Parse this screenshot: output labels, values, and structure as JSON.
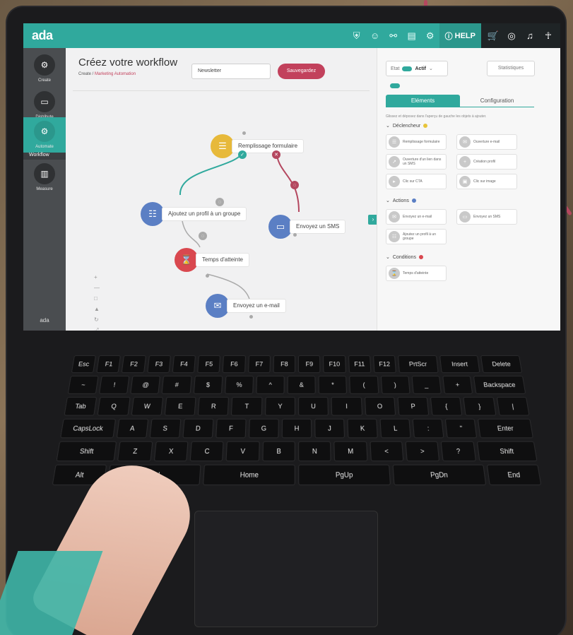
{
  "app": {
    "logo": "ada",
    "help_label": "HELP"
  },
  "topbar": {
    "icons": [
      "shield-icon",
      "face-icon",
      "connections-icon",
      "document-icon",
      "settings-icon"
    ],
    "account_icons": [
      "cart-icon",
      "refresh-icon",
      "bell-icon",
      "user-icon"
    ]
  },
  "sidebar": {
    "items": [
      {
        "label": "Create",
        "icon": "gears-icon"
      },
      {
        "label": "Distribute",
        "icon": "chat-icon"
      },
      {
        "label": "Automate",
        "icon": "automation-icon"
      },
      {
        "label": "Measure",
        "icon": "chart-icon"
      }
    ],
    "sub_label": "Workflow",
    "footer_logo": "ada"
  },
  "header": {
    "title": "Créez votre workflow",
    "crumb_root": "Create / ",
    "crumb_current": "Marketing Automation",
    "name_value": "Newsletter",
    "save_label": "Sauvegardez"
  },
  "workflow": {
    "nodes": [
      {
        "id": "n1",
        "label": "Remplissage formulaire",
        "color": "#e7b93a"
      },
      {
        "id": "n2",
        "label": "Ajoutez un profil à un groupe",
        "color": "#5b7fc4"
      },
      {
        "id": "n3",
        "label": "Envoyez un SMS",
        "color": "#5b7fc4"
      },
      {
        "id": "n4",
        "label": "Temps d'atteinte",
        "color": "#d9484f"
      },
      {
        "id": "n5",
        "label": "Envoyez un e-mail",
        "color": "#5b7fc4"
      }
    ],
    "zoom_tools": [
      "+",
      "—",
      "□",
      "▲",
      "↻",
      "⤢"
    ]
  },
  "panel": {
    "state_label": "Etat",
    "state_value": "Actif",
    "stats_label": "Statistiques",
    "tabs": [
      "Eléments",
      "Configuration"
    ],
    "hint": "Glissez et déposez dans l'aperçu de gauche les objets à ajouter.",
    "sections": {
      "trigger": {
        "title": "Déclencheur",
        "color": "#e7c43a"
      },
      "actions": {
        "title": "Actions",
        "color": "#5b7fc4"
      },
      "conditions": {
        "title": "Conditions",
        "color": "#d9484f"
      }
    },
    "trigger_cards": [
      "Remplissage formulaire",
      "Ouverture e-mail",
      "Ouverture d'un lien dans un SMS",
      "Création profil",
      "Clic sur CTA",
      "Clic sur image"
    ],
    "action_cards": [
      "Envoyez un e-mail",
      "Envoyez un SMS",
      "Ajoutez un profil à un groupe"
    ],
    "condition_cards": [
      "Temps d'atteinte"
    ]
  },
  "keyboard": {
    "rows": [
      [
        "Esc",
        "F1",
        "F2",
        "F3",
        "F4",
        "F5",
        "F6",
        "F7",
        "F8",
        "F9",
        "F10",
        "F11",
        "F12",
        "PrtScr",
        "Insert",
        "Delete"
      ],
      [
        "~",
        "!",
        "@",
        "#",
        "$",
        "%",
        "^",
        "&",
        "*",
        "(",
        ")",
        "_",
        "+",
        "Backspace"
      ],
      [
        "Tab",
        "Q",
        "W",
        "E",
        "R",
        "T",
        "Y",
        "U",
        "I",
        "O",
        "P",
        "{",
        "}",
        "|"
      ],
      [
        "CapsLock",
        "A",
        "S",
        "D",
        "F",
        "G",
        "H",
        "J",
        "K",
        "L",
        ":",
        "\"",
        "Enter"
      ],
      [
        "Shift",
        "Z",
        "X",
        "C",
        "V",
        "B",
        "N",
        "M",
        "<",
        ">",
        "?",
        "Shift"
      ],
      [
        "Alt",
        "Ctrl",
        "Home",
        "PgUp",
        "PgDn",
        "End"
      ]
    ]
  }
}
